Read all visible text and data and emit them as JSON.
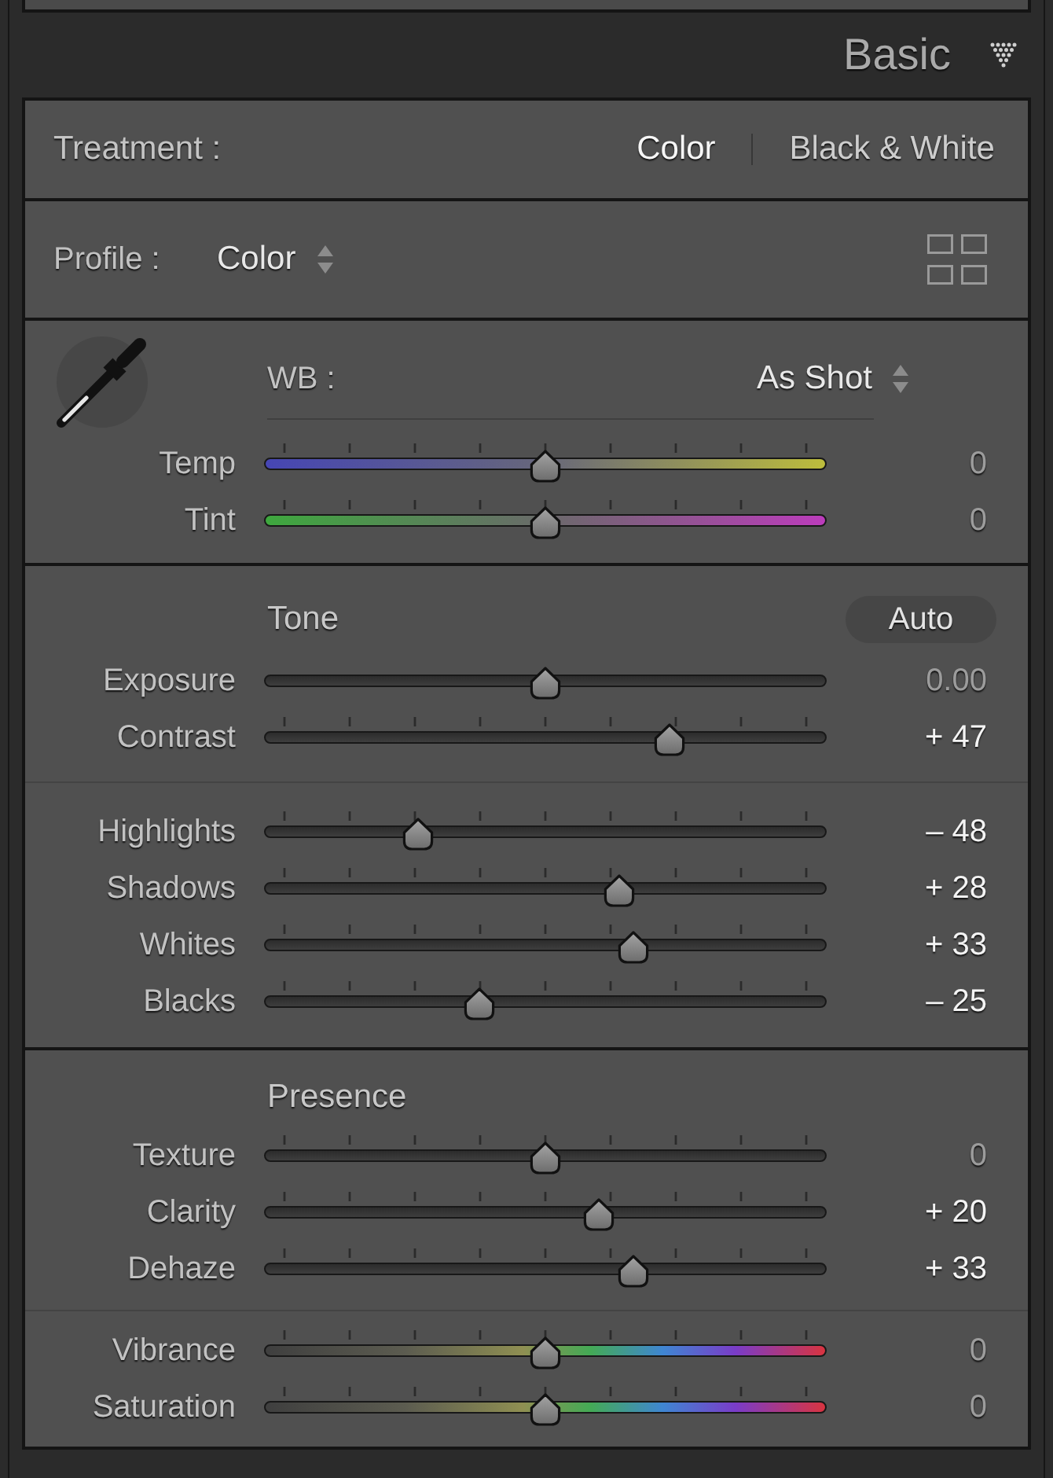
{
  "header": {
    "title": "Basic"
  },
  "treatment": {
    "label": "Treatment :",
    "options": [
      {
        "label": "Color",
        "selected": true
      },
      {
        "label": "Black & White",
        "selected": false
      }
    ]
  },
  "profile": {
    "label": "Profile :",
    "value": "Color"
  },
  "white_balance": {
    "label": "WB :",
    "value": "As Shot",
    "sliders": [
      {
        "label": "Temp",
        "kind": "temp",
        "ticks": true,
        "level": 0.5,
        "reading": "0",
        "modified": false
      },
      {
        "label": "Tint",
        "kind": "tint",
        "ticks": true,
        "level": 0.5,
        "reading": "0",
        "modified": false
      }
    ]
  },
  "tone": {
    "title": "Tone",
    "auto_button": "Auto",
    "groups": [
      {
        "sliders": [
          {
            "label": "Exposure",
            "kind": "plain",
            "ticks": false,
            "level": 0.5,
            "reading": "0.00",
            "modified": false
          },
          {
            "label": "Contrast",
            "kind": "plain",
            "ticks": true,
            "level": 0.735,
            "reading": "+ 47",
            "modified": true
          }
        ]
      },
      {
        "sliders": [
          {
            "label": "Highlights",
            "kind": "plain",
            "ticks": true,
            "level": 0.26,
            "reading": "– 48",
            "modified": true
          },
          {
            "label": "Shadows",
            "kind": "plain",
            "ticks": true,
            "level": 0.64,
            "reading": "+ 28",
            "modified": true
          },
          {
            "label": "Whites",
            "kind": "plain",
            "ticks": true,
            "level": 0.665,
            "reading": "+ 33",
            "modified": true
          },
          {
            "label": "Blacks",
            "kind": "plain",
            "ticks": true,
            "level": 0.375,
            "reading": "– 25",
            "modified": true
          }
        ]
      }
    ]
  },
  "presence": {
    "title": "Presence",
    "groups": [
      {
        "sliders": [
          {
            "label": "Texture",
            "kind": "plain",
            "ticks": true,
            "level": 0.5,
            "reading": "0",
            "modified": false
          },
          {
            "label": "Clarity",
            "kind": "plain",
            "ticks": true,
            "level": 0.6,
            "reading": "+ 20",
            "modified": true
          },
          {
            "label": "Dehaze",
            "kind": "plain",
            "ticks": true,
            "level": 0.665,
            "reading": "+ 33",
            "modified": true
          }
        ]
      },
      {
        "sliders": [
          {
            "label": "Vibrance",
            "kind": "spectrum",
            "ticks": true,
            "level": 0.5,
            "reading": "0",
            "modified": false
          },
          {
            "label": "Saturation",
            "kind": "spectrum",
            "ticks": true,
            "level": 0.5,
            "reading": "0",
            "modified": false
          }
        ]
      }
    ]
  }
}
